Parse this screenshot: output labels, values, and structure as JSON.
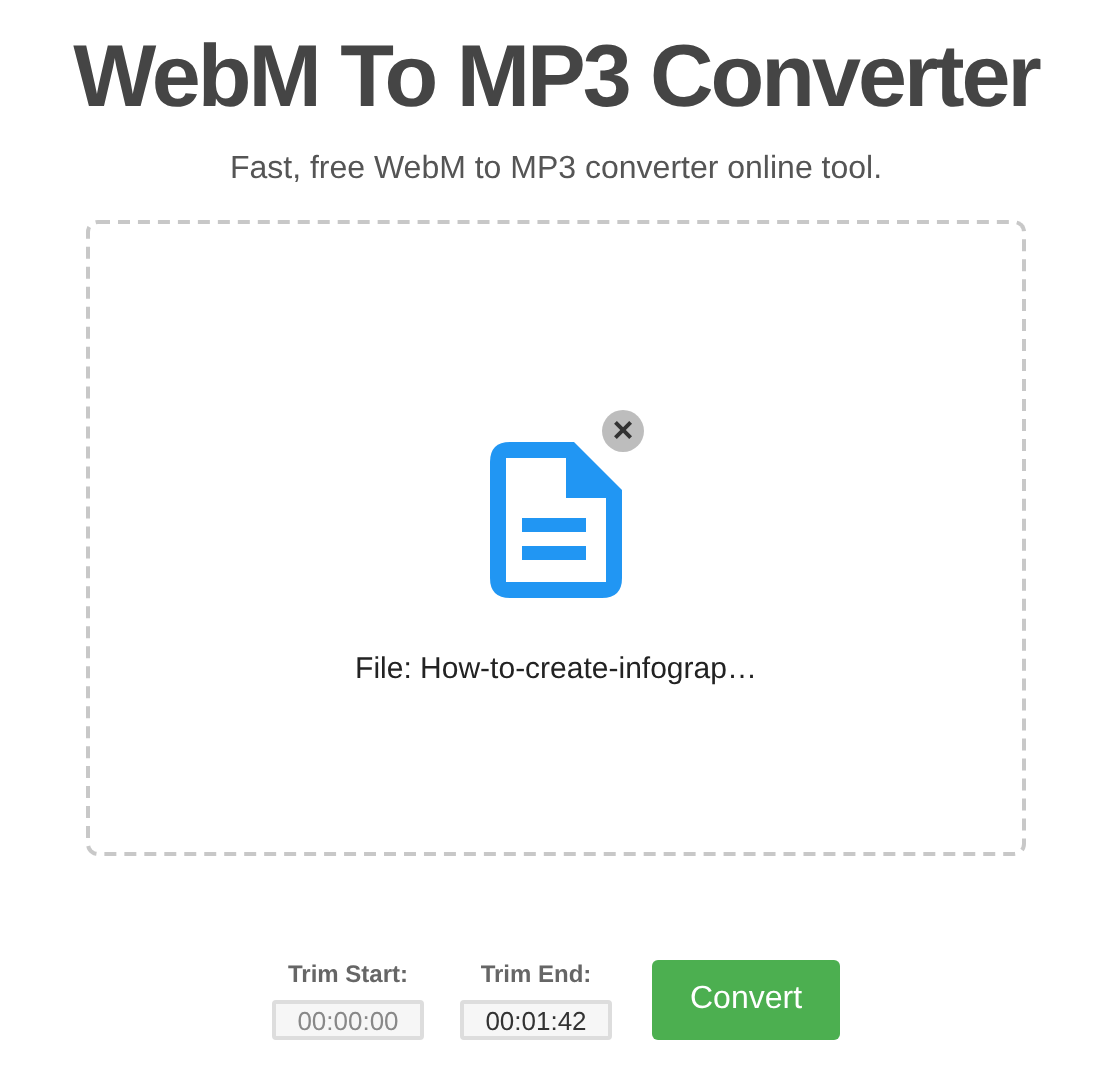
{
  "title": "WebM To MP3 Converter",
  "subtitle": "Fast, free WebM to MP3 converter online tool.",
  "file": {
    "label": "File: How-to-create-infograp…",
    "remove": "×"
  },
  "trim": [
    {
      "label": "Trim Start:",
      "placeholder": "00:00:00"
    },
    {
      "label": "Trim End:",
      "value": "00:01:42"
    }
  ],
  "convert": "Convert"
}
